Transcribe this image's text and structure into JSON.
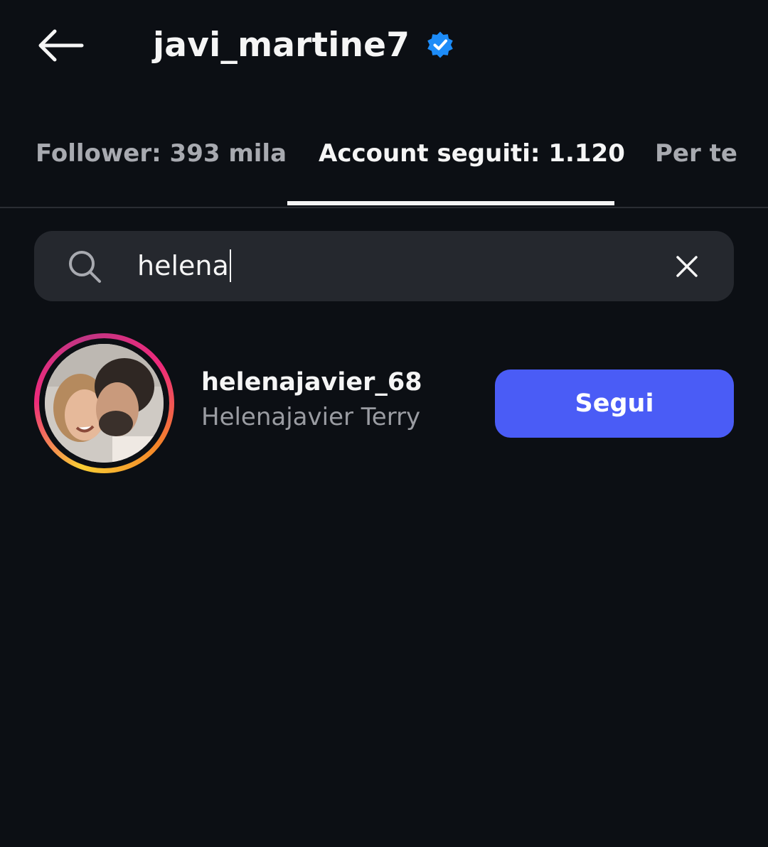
{
  "header": {
    "back_icon": "arrow-left-icon",
    "title": "javi_martine7",
    "verified_icon": "verified-badge-icon",
    "verified_color": "#1d8cf8"
  },
  "tabs": [
    {
      "label": "Follower: 393 mila",
      "active": false
    },
    {
      "label": "Account seguiti: 1.120",
      "active": true
    },
    {
      "label": "Per te",
      "active": false
    }
  ],
  "search": {
    "icon": "search-icon",
    "value": "helena",
    "clear_icon": "close-icon"
  },
  "results": [
    {
      "username": "helenajavier_68",
      "full_name": "Helenajavier Terry",
      "has_story_ring": true,
      "button_label": "Segui",
      "button_color": "#4a5cf6"
    }
  ]
}
